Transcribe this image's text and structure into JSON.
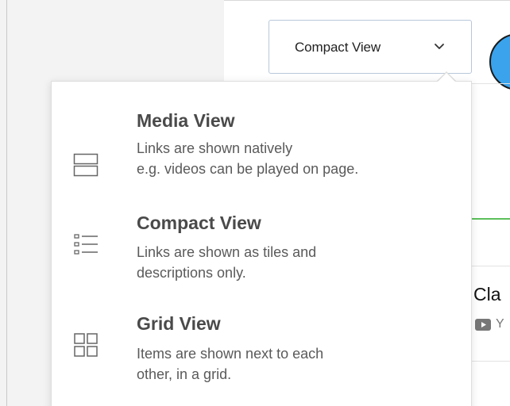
{
  "view_selector": {
    "selected": "Compact View"
  },
  "menu": {
    "items": [
      {
        "icon": "media-view-icon",
        "title": "Media View",
        "description_line1": "Links are shown natively",
        "description_line2": "e.g. videos can be played on page."
      },
      {
        "icon": "compact-view-icon",
        "title": "Compact View",
        "description_line1": "Links are shown as tiles and",
        "description_line2": "descriptions only."
      },
      {
        "icon": "grid-view-icon",
        "title": "Grid View",
        "description_line1": "Items are shown next to each",
        "description_line2": "other, in a grid."
      }
    ]
  },
  "background": {
    "partial_title": "Cla",
    "partial_meta": "Y"
  },
  "colors": {
    "accent_blue": "#3aa3ec",
    "green_line": "#5bbf5b",
    "select_border": "#b9c7da"
  }
}
